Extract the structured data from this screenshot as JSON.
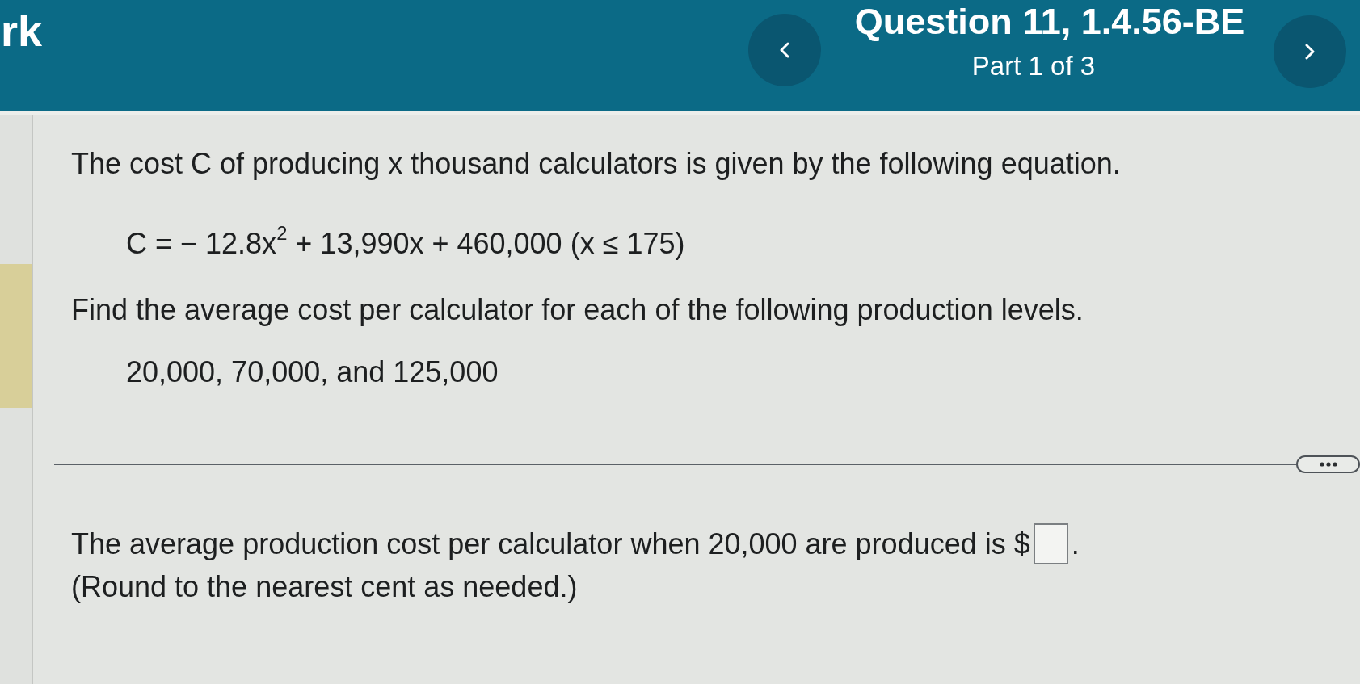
{
  "header": {
    "section_title": "rk",
    "question_title": "Question 11, 1.4.56-BE",
    "part_label": "Part 1 of 3"
  },
  "question": {
    "intro": "The cost C of producing x thousand calculators is given by the following equation.",
    "equation": "C = − 12.8x$^{2}$ + 13,990x + 460,000 (x ≤ 175)",
    "prompt": "Find the average cost per calculator for each of the following production levels.",
    "levels": "20,000, 70,000, and 125,000"
  },
  "answer": {
    "prefix": "The average production cost per calculator when 20,000 are produced is $",
    "suffix": ".",
    "hint": "(Round to the nearest cent as needed.)"
  }
}
